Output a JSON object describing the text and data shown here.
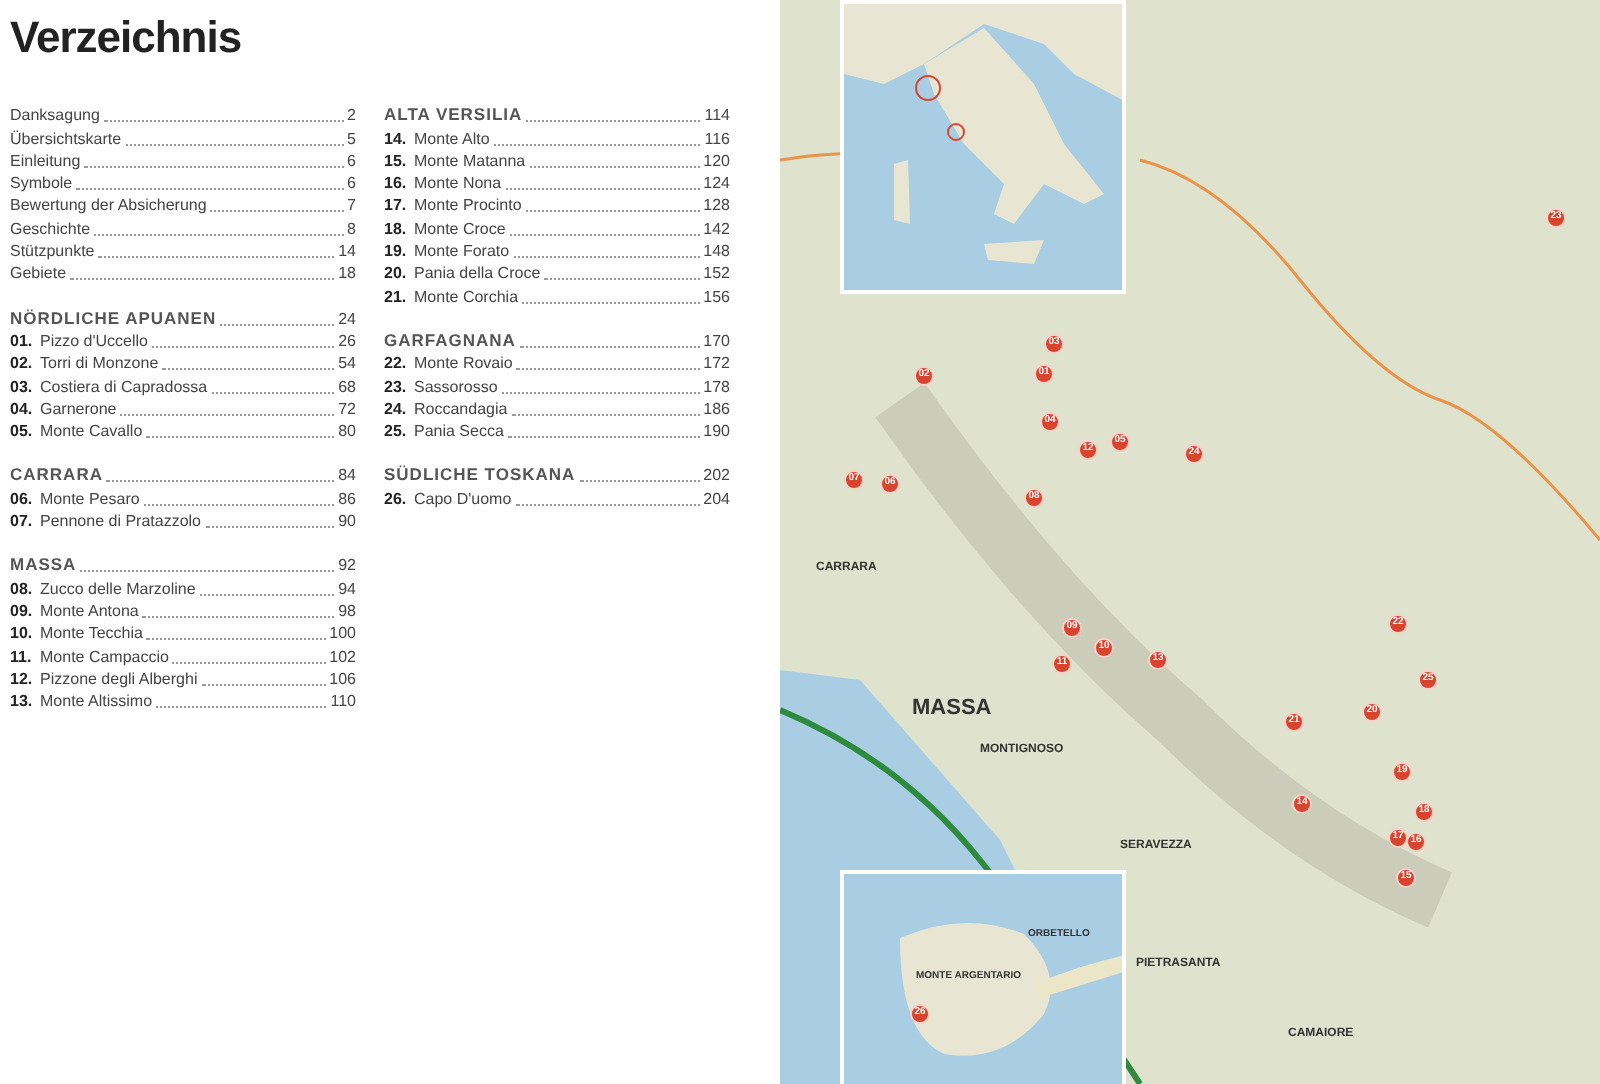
{
  "title": "Verzeichnis",
  "columns": [
    [
      {
        "entries": [
          {
            "title": "Danksagung",
            "page": "2"
          },
          {
            "title": "Übersichtskarte",
            "page": "5"
          },
          {
            "title": "Einleitung",
            "page": "6"
          },
          {
            "title": "Symbole",
            "page": "6"
          },
          {
            "title": "Bewertung der Absicherung",
            "page": "7"
          },
          {
            "title": "Geschichte",
            "page": "8"
          },
          {
            "title": "Stützpunkte",
            "page": "14"
          },
          {
            "title": "Gebiete",
            "page": "18"
          }
        ]
      },
      {
        "heading": {
          "title": "NÖRDLICHE APUANEN",
          "page": "24"
        },
        "entries": [
          {
            "number": "01.",
            "title": "Pizzo d'Uccello",
            "page": "26"
          },
          {
            "number": "02.",
            "title": "Torri di Monzone",
            "page": "54"
          },
          {
            "number": "03.",
            "title": "Costiera di Capradossa",
            "page": "68"
          },
          {
            "number": "04.",
            "title": "Garnerone",
            "page": "72"
          },
          {
            "number": "05.",
            "title": "Monte Cavallo",
            "page": "80"
          }
        ]
      },
      {
        "heading": {
          "title": "CARRARA",
          "page": "84"
        },
        "entries": [
          {
            "number": "06.",
            "title": "Monte Pesaro",
            "page": "86"
          },
          {
            "number": "07.",
            "title": "Pennone di Pratazzolo",
            "page": "90"
          }
        ]
      },
      {
        "heading": {
          "title": "MASSA",
          "page": "92"
        },
        "entries": [
          {
            "number": "08.",
            "title": "Zucco delle Marzoline",
            "page": "94"
          },
          {
            "number": "09.",
            "title": "Monte Antona",
            "page": "98"
          },
          {
            "number": "10.",
            "title": "Monte Tecchia",
            "page": "100"
          },
          {
            "number": "11.",
            "title": "Monte Campaccio",
            "page": "102"
          },
          {
            "number": "12.",
            "title": "Pizzone degli Alberghi",
            "page": "106"
          },
          {
            "number": "13.",
            "title": "Monte Altissimo",
            "page": "110"
          }
        ]
      }
    ],
    [
      {
        "heading": {
          "title": "ALTA VERSILIA",
          "page": "114"
        },
        "entries": [
          {
            "number": "14.",
            "title": "Monte Alto",
            "page": "116"
          },
          {
            "number": "15.",
            "title": "Monte Matanna",
            "page": "120"
          },
          {
            "number": "16.",
            "title": "Monte Nona",
            "page": "124"
          },
          {
            "number": "17.",
            "title": "Monte Procinto",
            "page": "128"
          },
          {
            "number": "18.",
            "title": "Monte Croce",
            "page": "142"
          },
          {
            "number": "19.",
            "title": "Monte Forato",
            "page": "148"
          },
          {
            "number": "20.",
            "title": "Pania della Croce",
            "page": "152"
          },
          {
            "number": "21.",
            "title": "Monte Corchia",
            "page": "156"
          }
        ]
      },
      {
        "heading": {
          "title": "GARFAGNANA",
          "page": "170"
        },
        "entries": [
          {
            "number": "22.",
            "title": "Monte Rovaio",
            "page": "172"
          },
          {
            "number": "23.",
            "title": "Sassorosso",
            "page": "178"
          },
          {
            "number": "24.",
            "title": "Roccandagia",
            "page": "186"
          },
          {
            "number": "25.",
            "title": "Pania Secca",
            "page": "190"
          }
        ]
      },
      {
        "heading": {
          "title": "SÜDLICHE TOSKANA",
          "page": "202"
        },
        "entries": [
          {
            "number": "26.",
            "title": "Capo D'uomo",
            "page": "204"
          }
        ]
      }
    ]
  ],
  "map": {
    "labels": [
      {
        "text": "CARRARA"
      },
      {
        "text": "MASSA"
      },
      {
        "text": "MONTIGNOSO"
      },
      {
        "text": "SERAVEZZA"
      },
      {
        "text": "PIETRASANTA"
      },
      {
        "text": "CAMAIORE"
      }
    ],
    "inset_labels": [
      {
        "text": "ORBETELLO"
      },
      {
        "text": "MONTE ARGENTARIO"
      }
    ],
    "markers": [
      {
        "label": "23"
      },
      {
        "label": "03"
      },
      {
        "label": "02"
      },
      {
        "label": "01"
      },
      {
        "label": "04"
      },
      {
        "label": "12"
      },
      {
        "label": "05"
      },
      {
        "label": "24"
      },
      {
        "label": "07"
      },
      {
        "label": "06"
      },
      {
        "label": "08"
      },
      {
        "label": "09"
      },
      {
        "label": "10"
      },
      {
        "label": "11"
      },
      {
        "label": "13"
      },
      {
        "label": "22"
      },
      {
        "label": "25"
      },
      {
        "label": "21"
      },
      {
        "label": "20"
      },
      {
        "label": "19"
      },
      {
        "label": "14"
      },
      {
        "label": "18"
      },
      {
        "label": "17"
      },
      {
        "label": "16"
      },
      {
        "label": "15"
      }
    ],
    "inset_markers": [
      {
        "label": "26"
      }
    ]
  }
}
